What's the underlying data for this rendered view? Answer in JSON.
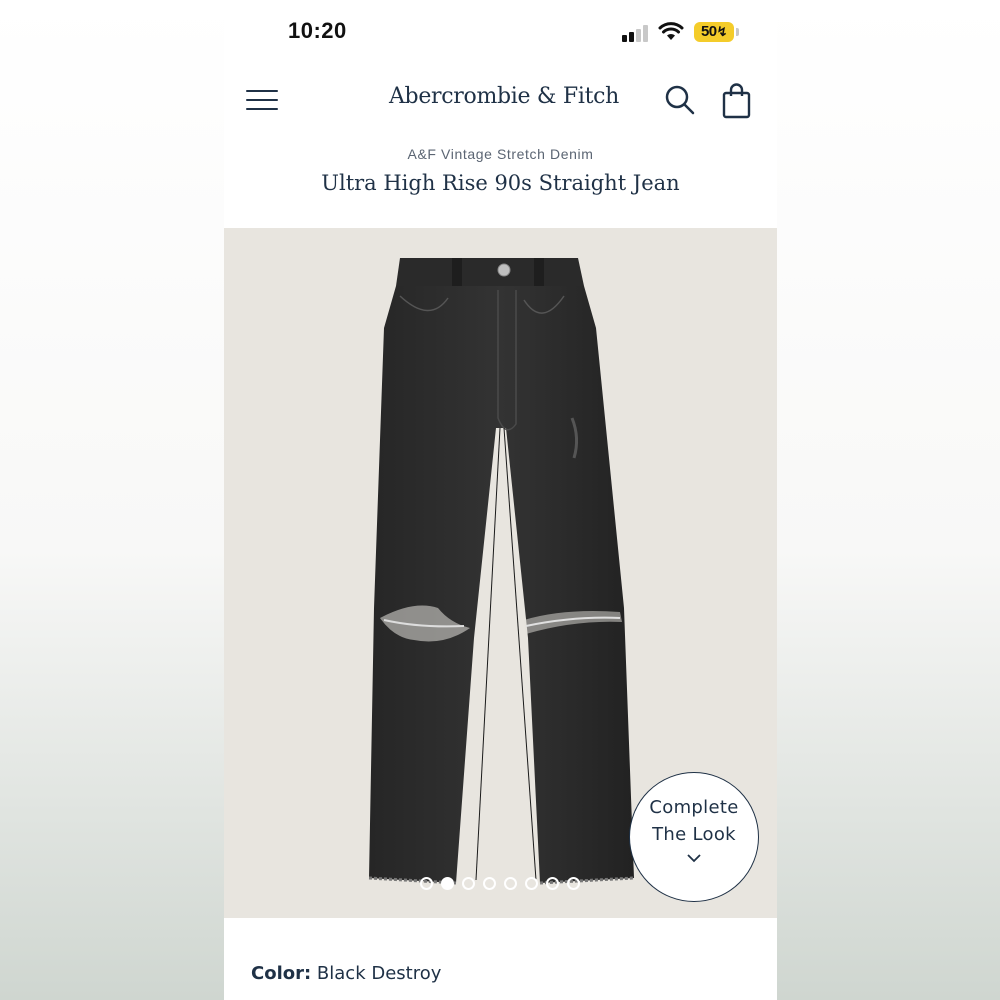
{
  "status_bar": {
    "time": "10:20",
    "battery": "50"
  },
  "header": {
    "brand": "Abercrombie & Fitch",
    "icons": [
      "menu-icon",
      "search-icon",
      "shopping-bag-icon"
    ]
  },
  "product": {
    "collection": "A&F Vintage Stretch Denim",
    "title": "Ultra High Rise 90s Straight Jean",
    "color_label": "Color:",
    "color_value": "Black Destroy"
  },
  "gallery": {
    "image_count": 8,
    "active_index": 1
  },
  "complete_look": {
    "line1": "Complete",
    "line2": "The Look"
  },
  "colors": {
    "brand_navy": "#1f3146",
    "battery_yellow": "#f4cc2a",
    "image_bg": "#e8e5df"
  }
}
